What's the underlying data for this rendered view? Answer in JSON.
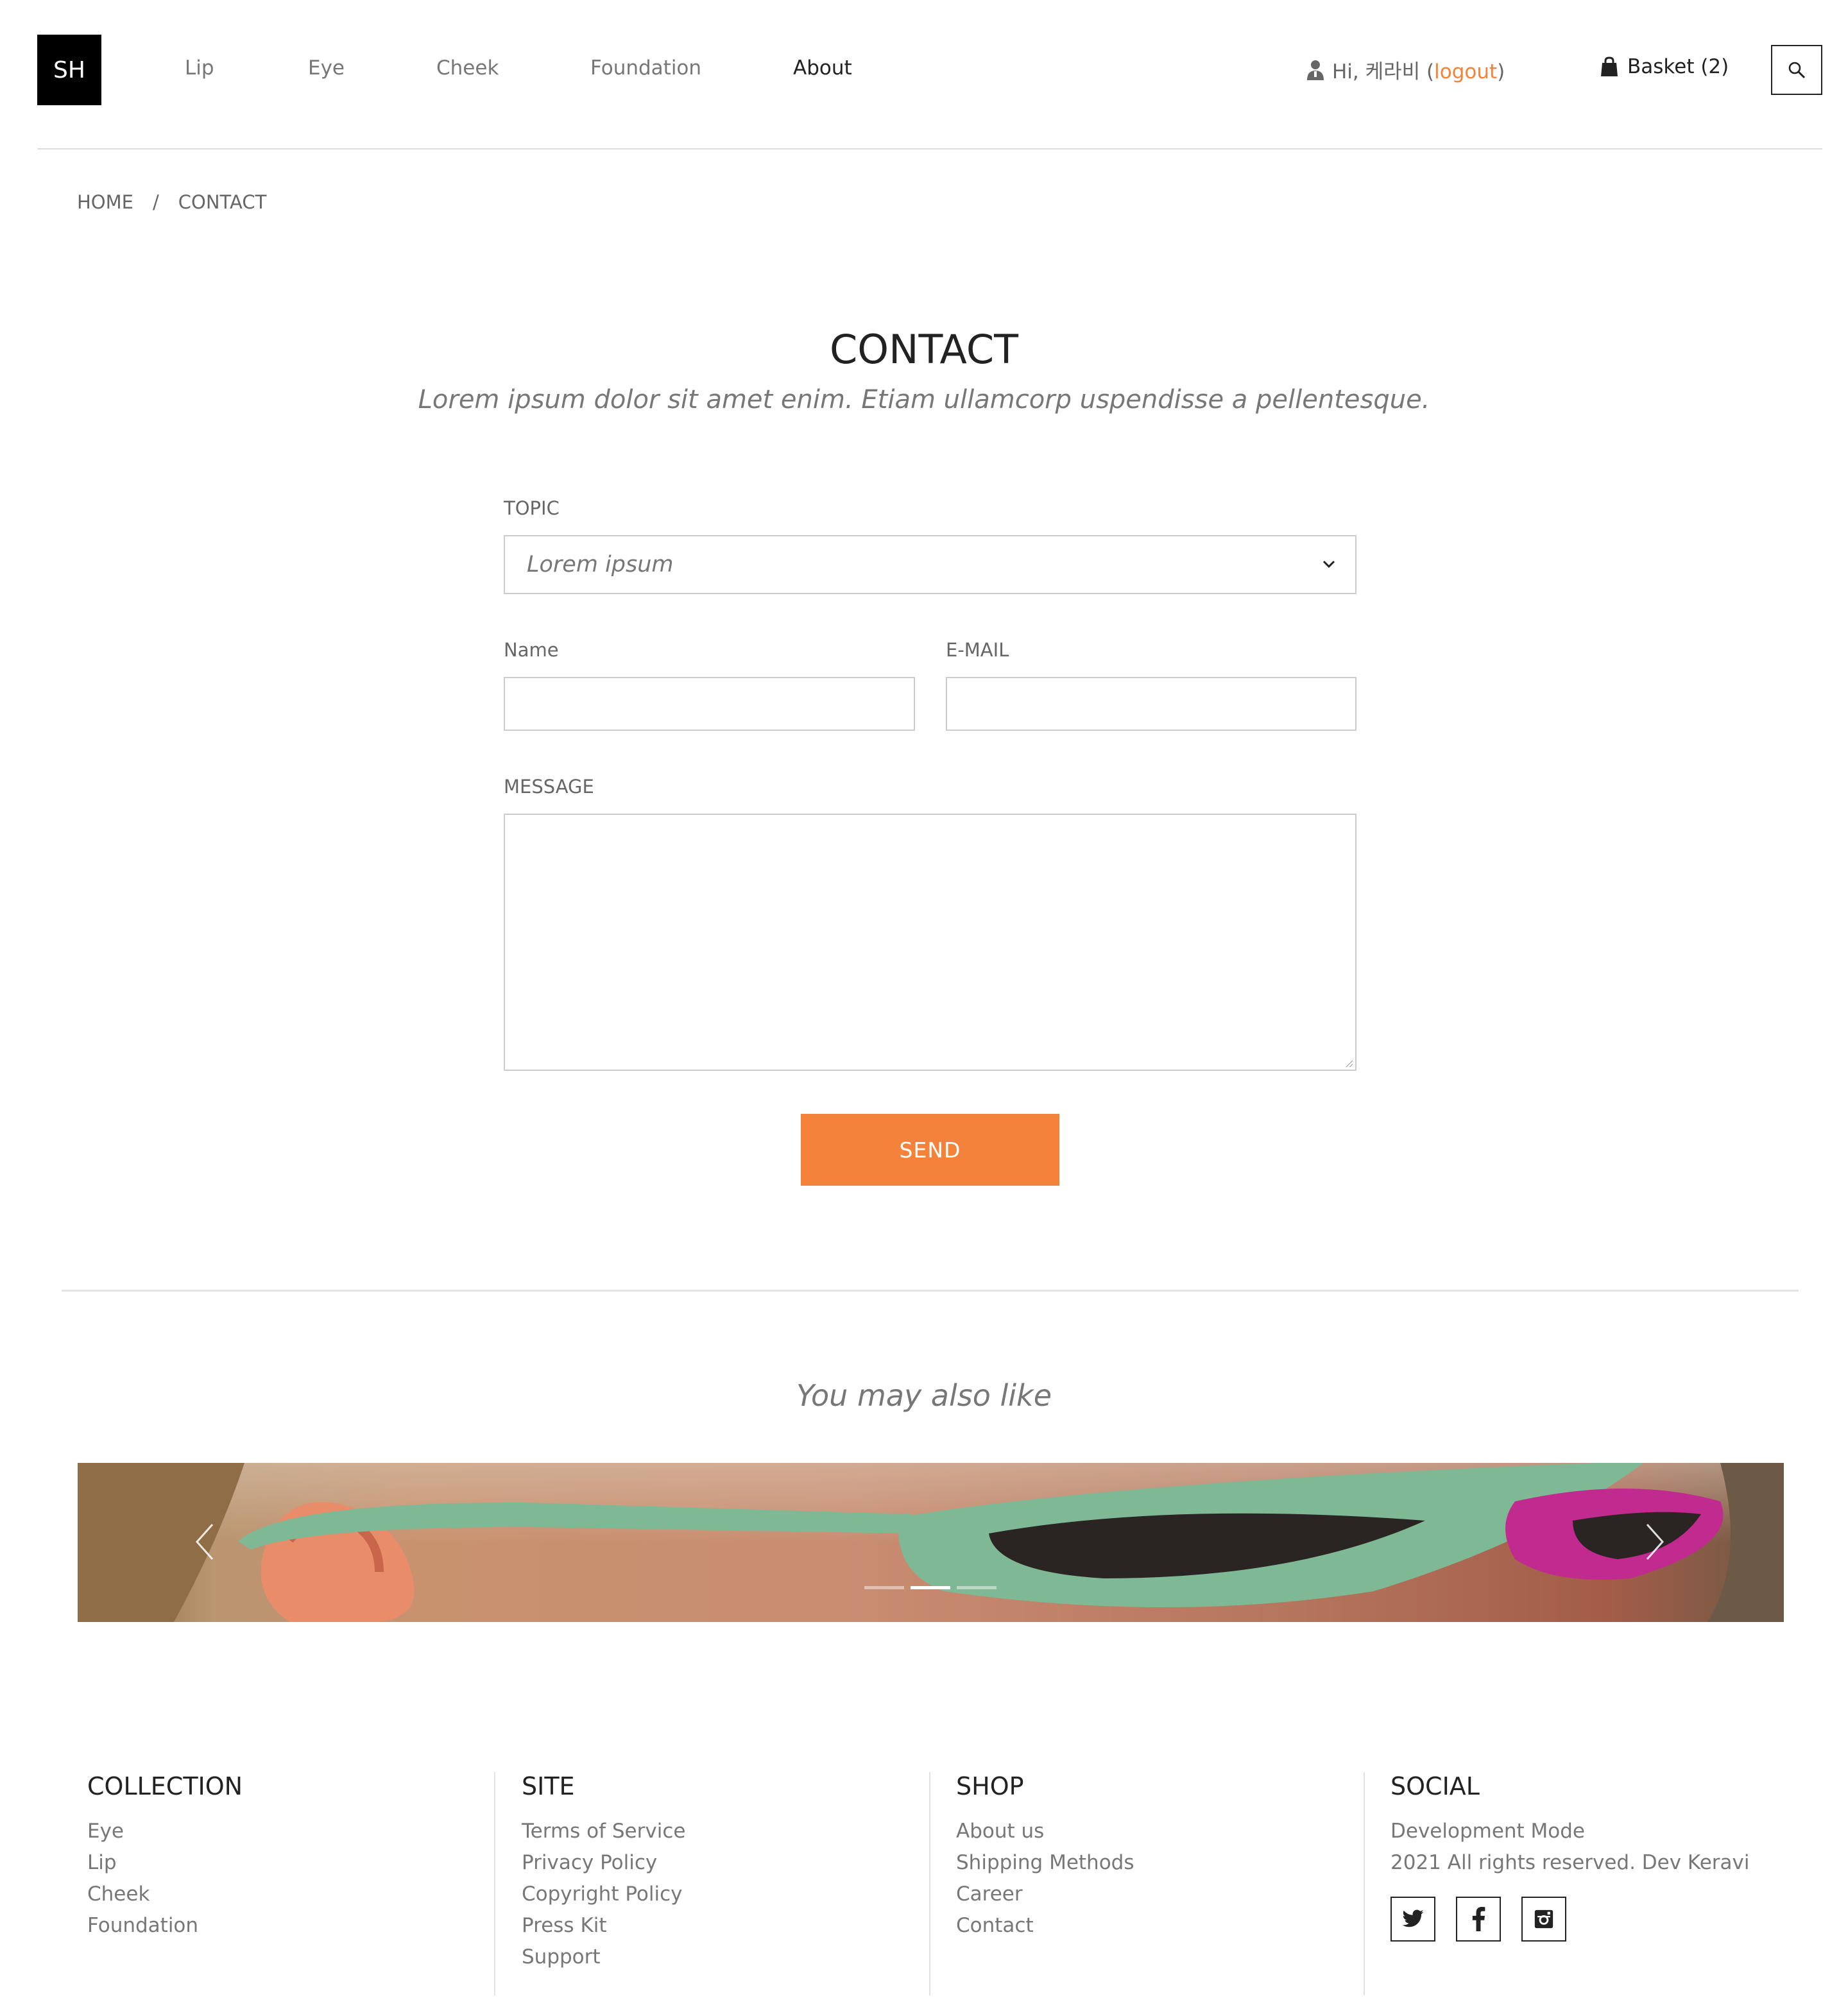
{
  "header": {
    "logo": "SH",
    "nav": [
      "Lip",
      "Eye",
      "Cheek",
      "Foundation",
      "About"
    ],
    "active_nav": "About",
    "user_greeting": "Hi, 케라비 (",
    "logout_label": "logout",
    "user_close": ")",
    "basket_label": "Basket (2)"
  },
  "breadcrumb": {
    "home": "HOME",
    "separator": "/",
    "current": "CONTACT"
  },
  "page": {
    "title": "CONTACT",
    "subtitle": "Lorem ipsum dolor sit amet enim. Etiam ullamcorp uspendisse a pellentesque."
  },
  "form": {
    "topic_label": "TOPIC",
    "topic_value": "Lorem ipsum",
    "name_label": "Name",
    "name_value": "",
    "email_label": "E-MAIL",
    "email_value": "",
    "message_label": "MESSAGE",
    "message_value": "",
    "send_label": "SEND"
  },
  "recommend": {
    "heading": "You may also like",
    "slide_count": 3,
    "active_slide": 2
  },
  "footer": {
    "collection": {
      "title": "COLLECTION",
      "links": [
        "Eye",
        "Lip",
        "Cheek",
        "Foundation"
      ]
    },
    "site": {
      "title": "SITE",
      "links": [
        "Terms of Service",
        "Privacy Policy",
        "Copyright Policy",
        "Press Kit",
        "Support"
      ]
    },
    "shop": {
      "title": "SHOP",
      "links": [
        "About us",
        "Shipping Methods",
        "Career",
        "Contact"
      ]
    },
    "social": {
      "title": "SOCIAL",
      "lines": [
        "Development Mode",
        "2021 All rights reserved. Dev Keravi"
      ],
      "icons": [
        "twitter-icon",
        "facebook-icon",
        "instagram-icon"
      ]
    }
  },
  "colors": {
    "accent": "#f4823a",
    "logo_bg": "#000000",
    "border": "#cccccc"
  }
}
